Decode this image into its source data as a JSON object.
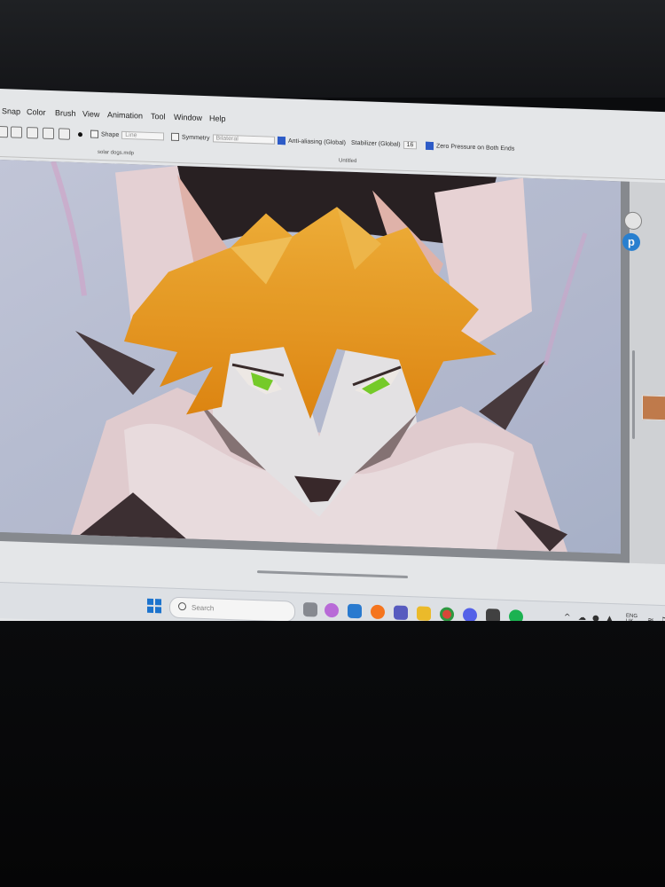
{
  "menu": [
    "Snap",
    "Color",
    "Brush",
    "View",
    "Animation",
    "Tool",
    "Window",
    "Help"
  ],
  "toolbar": {
    "shape_label": "Shape",
    "shape_value": "Line",
    "symmetry_label": "Symmetry",
    "symmetry_value": "Bilateral",
    "antialias_label": "Anti-aliasing (Global)",
    "stabilizer_label": "Stabilizer (Global)",
    "stabilizer_value": "16",
    "zero_pressure_label": "Zero Pressure on Both Ends"
  },
  "tabs": {
    "file_tab": "solar dogs.mdp",
    "untitled_tab": "Untitled"
  },
  "sidebar": {
    "badge_letter": "p"
  },
  "taskbar": {
    "search_placeholder": "Search",
    "lang": "ENG",
    "region": "UK",
    "icons": [
      "task-view-icon",
      "copilot-icon",
      "widgets-icon",
      "firefox-icon",
      "teams-icon",
      "file-explorer-icon",
      "chrome-icon",
      "discord-icon",
      "taskbar-app-icon",
      "spotify-icon"
    ]
  },
  "colors": {
    "accent_blue": "#2a84d8",
    "fur_orange": "#f0a21c",
    "eye_green": "#7ad22b",
    "canvas_bg": "#bfc6d6"
  }
}
